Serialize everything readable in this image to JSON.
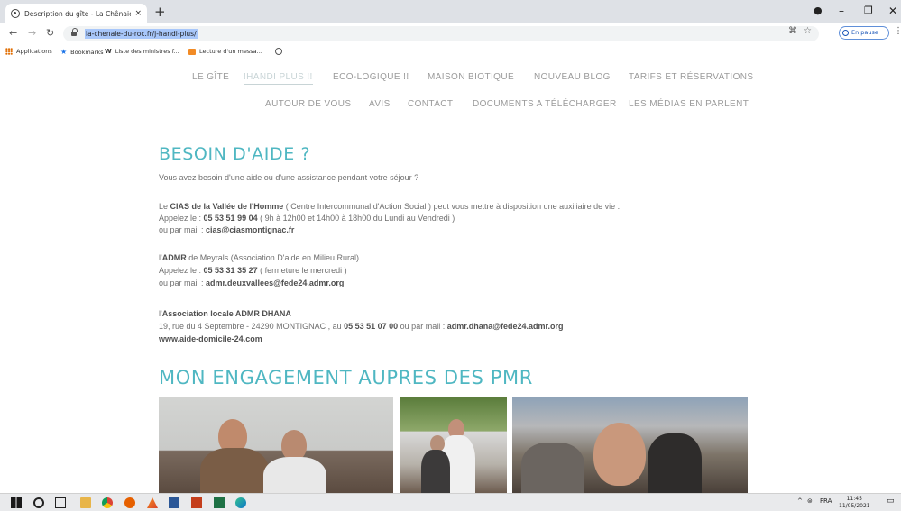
{
  "browser": {
    "tab_title": "Description du gîte - La Chênaie",
    "tab_close": "×",
    "new_tab": "+",
    "url": "la-chenaie-du-roc.fr/j-handi-plus/",
    "paused_label": "En pause",
    "window_controls": {
      "minimize": "–",
      "maximize": "❐",
      "close": "✕"
    }
  },
  "bookmarks": [
    {
      "label": "Applications",
      "icon": "apps-grid-icon"
    },
    {
      "label": "Bookmarks",
      "icon": "star-icon"
    },
    {
      "label": "Liste des ministres f...",
      "icon": "wikipedia-icon"
    },
    {
      "label": "Lecture d'un messa...",
      "icon": "mail-icon"
    },
    {
      "label": "",
      "icon": "globe-icon"
    }
  ],
  "site_nav": {
    "row1": [
      "LE GÎTE",
      "!HANDI PLUS !!",
      "ECO-LOGIQUE !!",
      "MAISON BIOTIQUE",
      "NOUVEAU BLOG",
      "TARIFS ET RÉSERVATIONS"
    ],
    "row2": [
      "AUTOUR DE VOUS",
      "AVIS",
      "CONTACT",
      "DOCUMENTS A TÉLÉCHARGER",
      "LES MÉDIAS EN PARLENT"
    ],
    "active": "!HANDI PLUS !!"
  },
  "content": {
    "heading1": "BESOIN D'AIDE ?",
    "intro": "Vous avez besoin d'une aide ou d'une assistance pendant votre séjour ?",
    "cias": {
      "p1_pre": "Le ",
      "p1_bold": "CIAS de la Vallée de l'Homme",
      "p1_post": " ( Centre Intercommunal d'Action Social ) peut vous mettre à disposition une auxiliaire de vie .",
      "p2_pre": "Appelez le : ",
      "p2_bold": "05 53 51 99 04",
      "p2_post": "  ( 9h à 12h00 et 14h00 à 18h00 du Lundi au Vendredi )",
      "p3_pre": "ou par mail : ",
      "p3_bold": "cias@ciasmontignac.fr"
    },
    "admr": {
      "p1_pre": " l'",
      "p1_bold": "ADMR",
      "p1_post": " de Meyrals (Association D'aide en Milieu Rural)",
      "p2_pre": "Appelez le :  ",
      "p2_bold": "05 53 31 35 27",
      "p2_post": " ( fermeture le mercredi )",
      "p3_pre": "ou par mail : ",
      "p3_bold": "admr.deuxvallees@fede24.admr.org"
    },
    "dhana": {
      "p1_pre": "l'",
      "p1_bold": "Association locale ADMR DHANA",
      "p2_pre": "19, rue du 4 Septembre - 24290 MONTIGNAC , au ",
      "p2_bold1": "05 53 51 07 00",
      "p2_mid": " ou par mail : ",
      "p2_bold2": "admr.dhana@fede24.admr.org",
      "p3_bold": "www.aide-domicile-24.com"
    },
    "heading2": "MON ENGAGEMENT AUPRES DES PMR"
  },
  "taskbar": {
    "lang": "FRA",
    "time": "11:45",
    "date": "11/05/2021"
  },
  "colors": {
    "heading": "#4fb7c2",
    "nav_text": "#9a9a9a",
    "body_text": "#6f6f6f",
    "url_highlight": "#a8c7fa"
  }
}
